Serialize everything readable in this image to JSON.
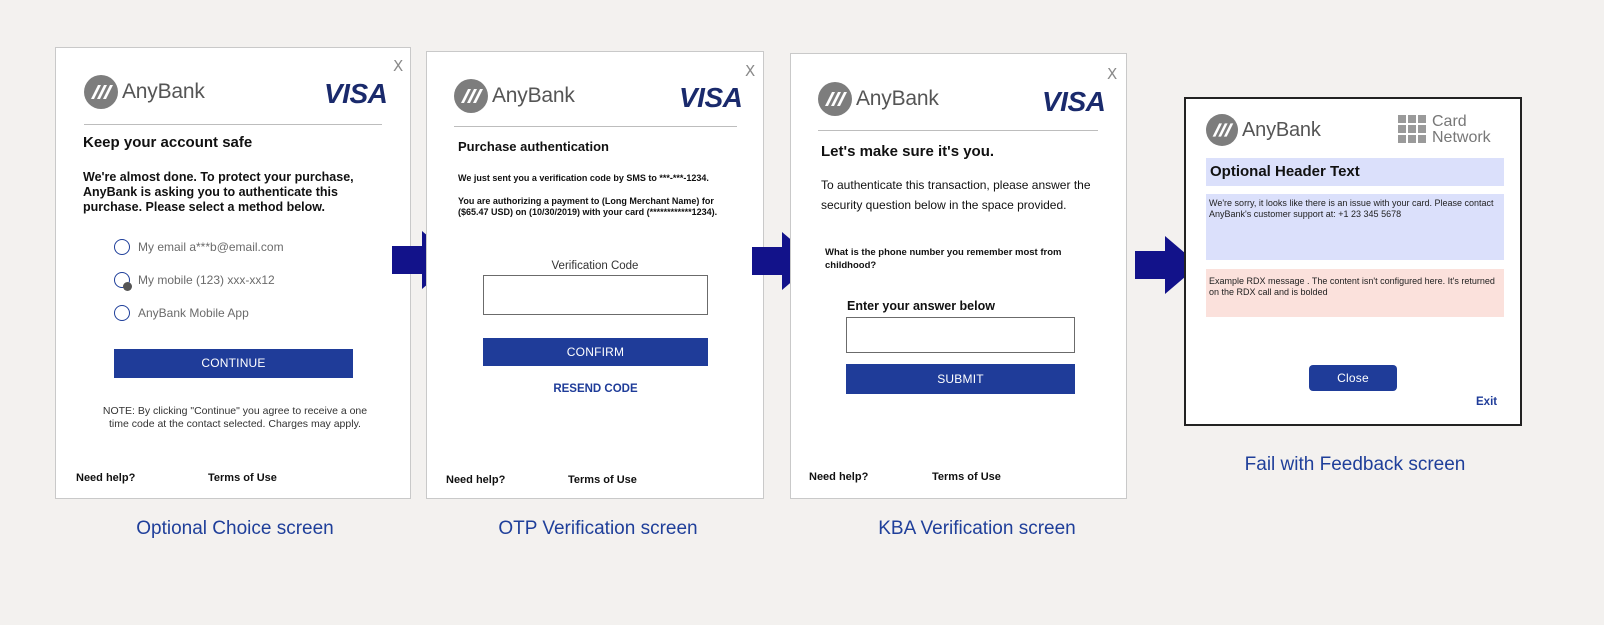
{
  "brand": {
    "bank": "AnyBank",
    "network": "VISA",
    "card_network": [
      "Card",
      "Network"
    ]
  },
  "colors": {
    "accent": "#1f3c99",
    "arrow": "#12128a",
    "caption": "#1f3f9a",
    "background": "#f3f1ef"
  },
  "common": {
    "close": "X",
    "need_help": "Need help?",
    "terms": "Terms of Use"
  },
  "screen1": {
    "title": "Keep your account safe",
    "intro": "We're almost done. To protect your purchase, AnyBank is asking you to authenticate this purchase. Please select a method below.",
    "options": [
      "My email a***b@email.com",
      "My mobile (123) xxx-xx12",
      "AnyBank Mobile App"
    ],
    "button": "CONTINUE",
    "note": "NOTE: By clicking \"Continue\" you agree to receive a one time code at the contact selected. Charges may apply.",
    "caption": "Optional Choice screen"
  },
  "screen2": {
    "title": "Purchase authentication",
    "sms_text": "We just sent you a verification code by SMS to ***-***-1234.",
    "auth_text": "You are authorizing a payment to (Long Merchant Name) for ($65.47 USD) on (10/30/2019) with your card (************1234).",
    "field_label": "Verification Code",
    "button": "CONFIRM",
    "resend": "RESEND CODE",
    "caption": "OTP Verification screen"
  },
  "screen3": {
    "title": "Let's make sure it's you.",
    "intro": "To authenticate this transaction, please answer the security question below in the space provided.",
    "question": "What is the phone number you remember most from childhood?",
    "answer_label": "Enter your answer below",
    "button": "SUBMIT",
    "caption": "KBA Verification screen"
  },
  "screen4": {
    "header": "Optional Header Text",
    "message": "We're sorry, it looks like there is an issue with your card. Please contact AnyBank's customer support at: +1 23 345 5678",
    "rdx": "Example RDX message . The content isn't configured here. It's returned on the RDX call and is bolded",
    "button": "Close",
    "exit": "Exit",
    "caption": "Fail with Feedback screen"
  },
  "icons": [
    "anybank-logo-icon",
    "visa-logo",
    "close-icon",
    "radio-icon",
    "right-arrow-icon",
    "card-network-grid-icon"
  ]
}
